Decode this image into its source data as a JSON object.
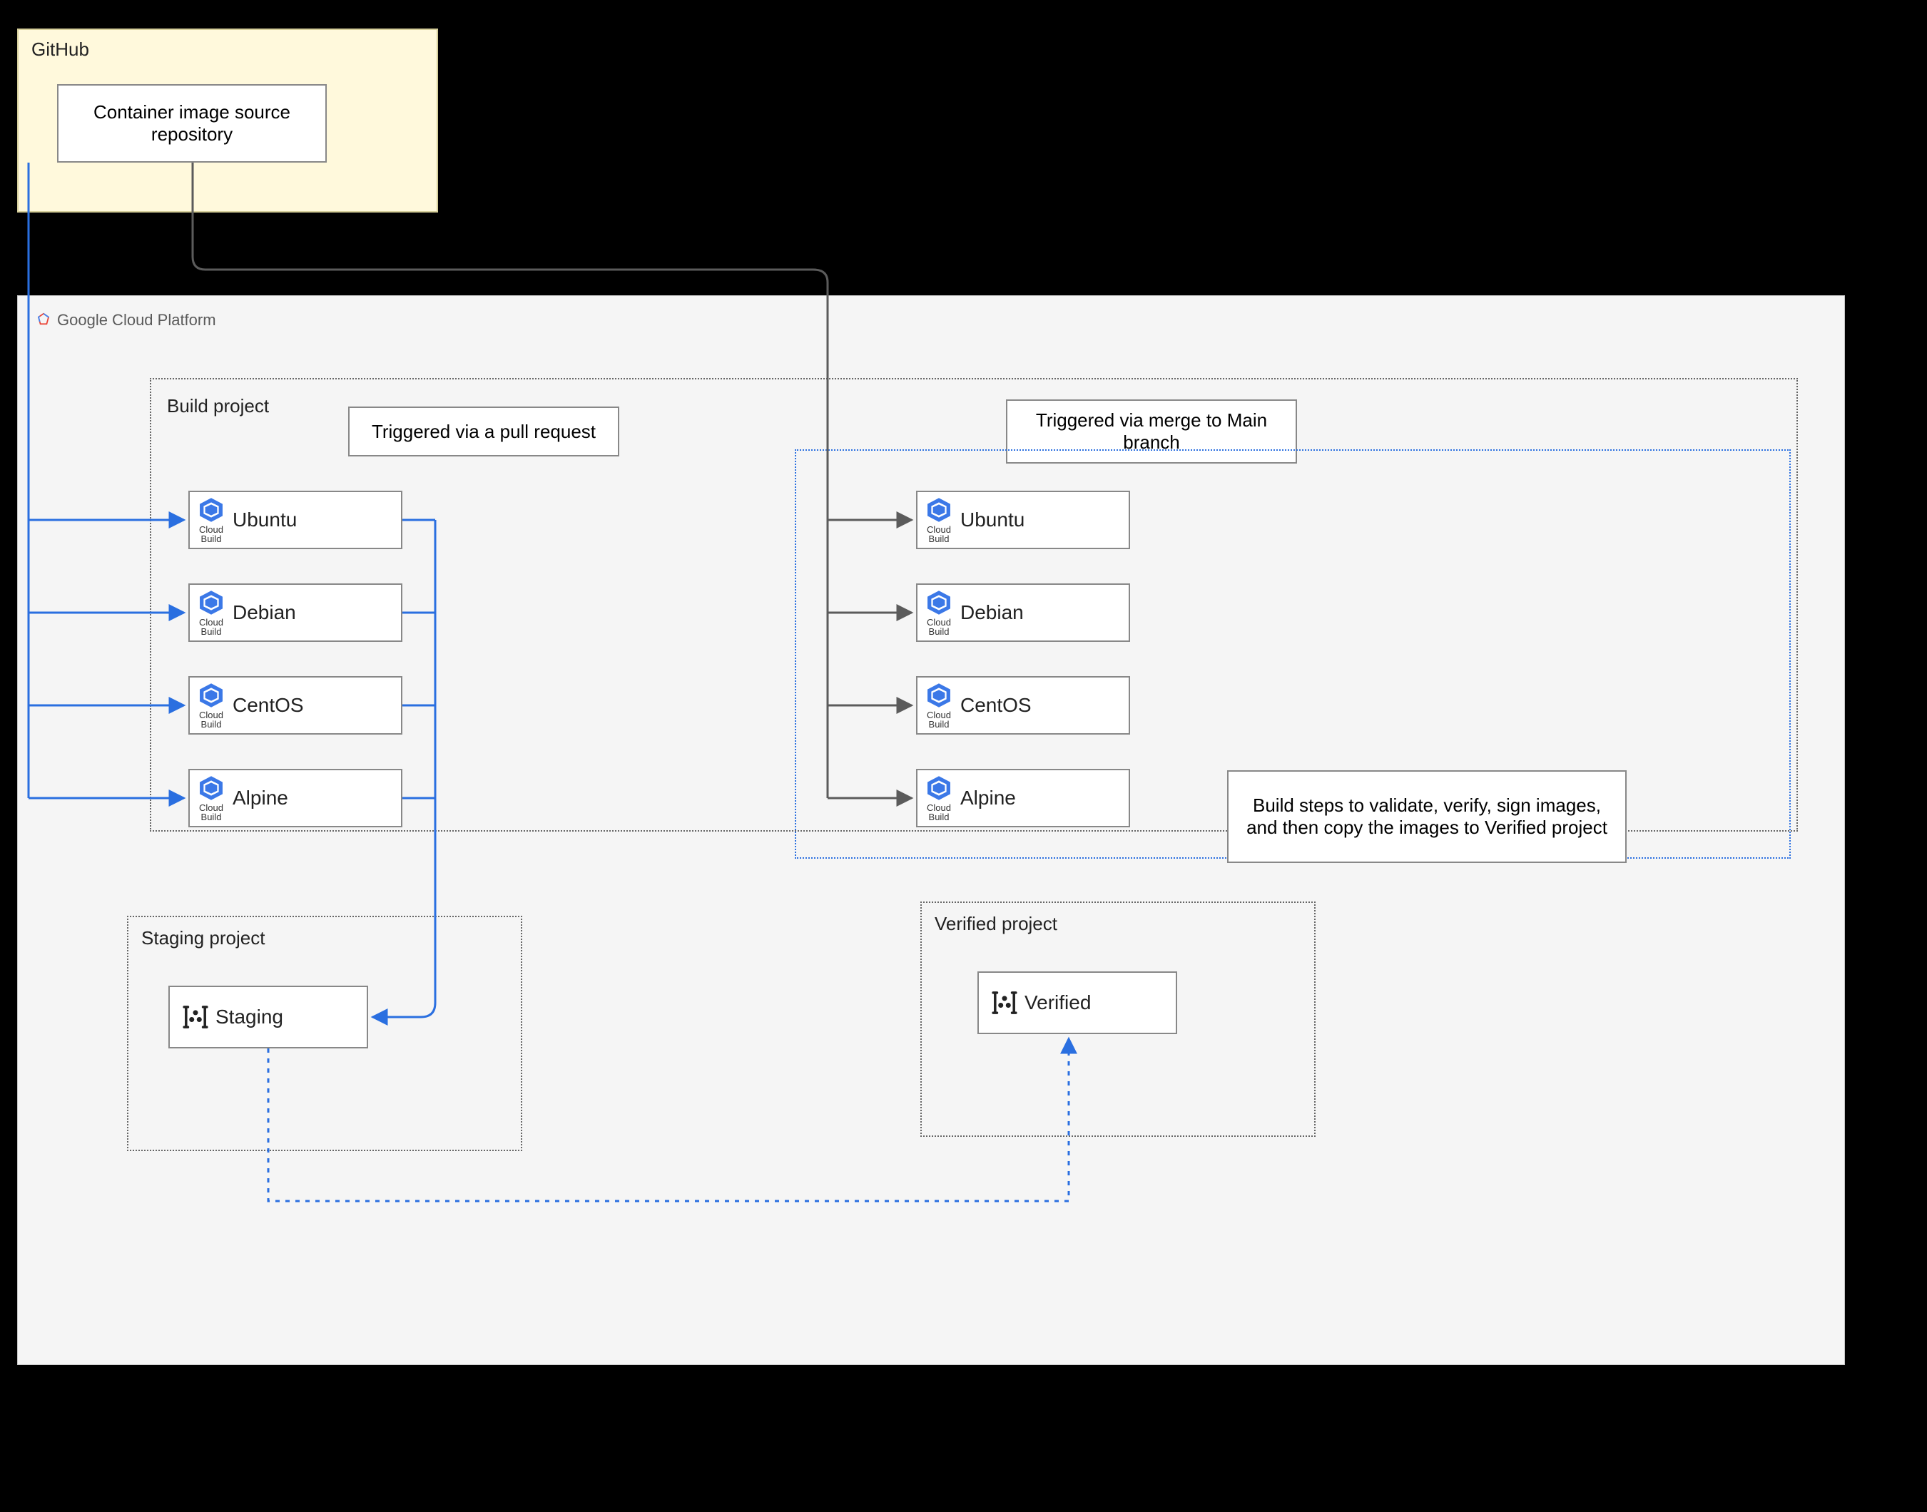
{
  "github": {
    "title": "GitHub",
    "source_repo_label": "Container image source repository"
  },
  "gcp": {
    "title": "Google Cloud Platform"
  },
  "build_project": {
    "title": "Build project",
    "pr_trigger": "Triggered via a pull request",
    "merge_trigger": "Triggered via merge to Main branch",
    "validate_note": "Build steps to validate, verify, sign images, and then copy the images to Verified project",
    "cb_caption": "Cloud\nBuild",
    "left": {
      "ubuntu": "Ubuntu",
      "debian": "Debian",
      "centos": "CentOS",
      "alpine": "Alpine"
    },
    "right": {
      "ubuntu": "Ubuntu",
      "debian": "Debian",
      "centos": "CentOS",
      "alpine": "Alpine"
    }
  },
  "staging_project": {
    "title": "Staging project",
    "registry": "Staging"
  },
  "verified_project": {
    "title": "Verified project",
    "registry": "Verified"
  }
}
